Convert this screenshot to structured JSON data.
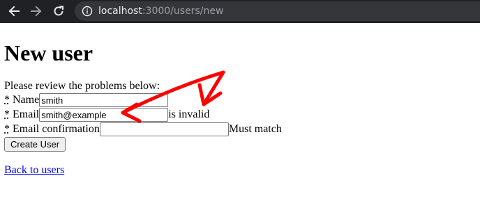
{
  "browser": {
    "url_host": "localhost",
    "url_rest": ":3000/users/new",
    "back_icon": "arrow-left-icon",
    "forward_icon": "arrow-right-icon",
    "reload_icon": "reload-icon",
    "site_info_icon": "info-circle-icon"
  },
  "page": {
    "title": "New user",
    "error_summary": "Please review the problems below:",
    "required_marker": "*",
    "fields": {
      "name": {
        "label": "Name",
        "value": "smith",
        "error": ""
      },
      "email": {
        "label": "Email",
        "value": "smith@example",
        "error": "is invalid"
      },
      "email_confirmation": {
        "label": "Email confirmation",
        "value": "",
        "error": "Must match"
      }
    },
    "submit_label": "Create User",
    "back_link": "Back to users"
  },
  "annotation": {
    "type": "red-arrow",
    "color": "#ff0000",
    "points_to": "email-field"
  }
}
